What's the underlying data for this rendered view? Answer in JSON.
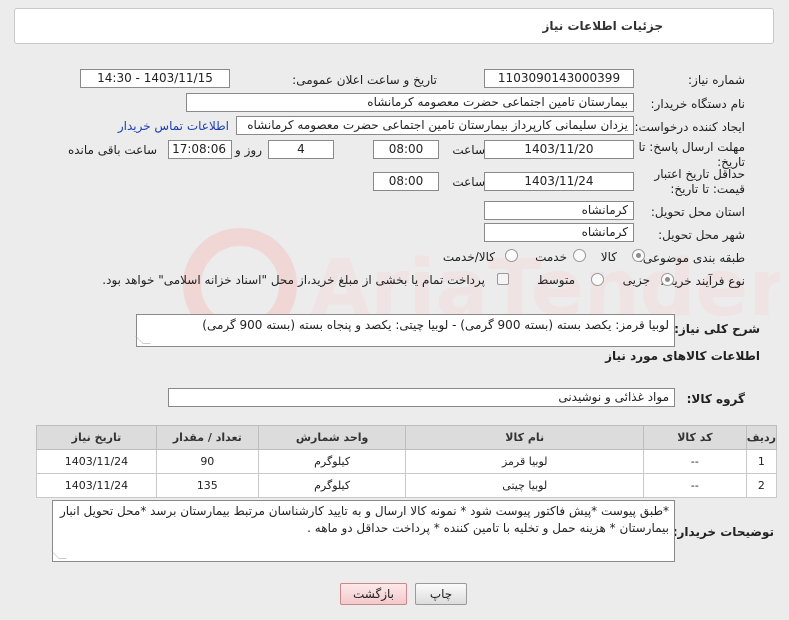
{
  "panel": {
    "title": "جزئیات اطلاعات نیاز"
  },
  "form": {
    "need_number_label": "شماره نیاز:",
    "need_number": "1103090143000399",
    "announce_datetime_label": "تاریخ و ساعت اعلان عمومی:",
    "announce_datetime": "1403/11/15 - 14:30",
    "buyer_org_label": "نام دستگاه خریدار:",
    "buyer_org": "بیمارستان تامین اجتماعی حضرت معصومه کرمانشاه",
    "requester_label": "ایجاد کننده درخواست:",
    "requester": "یزدان  سلیمانی کارپرداز بیمارستان تامین اجتماعی حضرت معصومه کرمانشاه",
    "contact_link": "اطلاعات تماس خریدار",
    "deadline_label": "مهلت ارسال پاسخ: تا تاریخ:",
    "deadline_date": "1403/11/20",
    "time_label": "ساعت",
    "deadline_time": "08:00",
    "days": "4",
    "days_label": "روز و",
    "remaining_time": "17:08:06",
    "remaining_label": "ساعت باقی مانده",
    "min_validity_label": "حداقل تاریخ اعتبار قیمت: تا تاریخ:",
    "validity_date": "1403/11/24",
    "validity_time": "08:00",
    "province_label": "استان محل تحویل:",
    "province": "کرمانشاه",
    "city_label": "شهر محل تحویل:",
    "city": "کرمانشاه",
    "category_label": "طبقه بندی موضوعی:",
    "category_options": [
      "کالا",
      "خدمت",
      "کالا/خدمت"
    ],
    "purchase_type_label": "نوع فرآیند خرید :",
    "purchase_options": [
      "جزیی",
      "متوسط"
    ],
    "treasury_note": "پرداخت تمام یا بخشی از مبلغ خرید،از محل \"اسناد خزانه اسلامی\" خواهد بود.",
    "description_label": "شرح کلی نیاز:",
    "description": "لوبیا قرمز: یکصد بسته (بسته 900 گرمی) - لوبیا چیتی: یکصد و پنجاه بسته (بسته 900 گرمی)",
    "goods_info_title": "اطلاعات کالاهای مورد نیاز",
    "goods_group_label": "گروه کالا:",
    "goods_group": "مواد غذائی و نوشیدنی",
    "buyer_notes_label": "توضیحات خریدار:",
    "buyer_notes": "*طبق پیوست *پیش فاکتور پیوست شود * نمونه کالا ارسال و به تایید کارشناسان مرتبط بیمارستان برسد *محل تحویل انبار بیمارستان * هزینه حمل و تخلیه با تامین کننده * پرداخت حداقل دو ماهه ."
  },
  "table": {
    "headers": [
      "ردیف",
      "کد کالا",
      "نام کالا",
      "واحد شمارش",
      "تعداد / مقدار",
      "تاریخ نیاز"
    ],
    "rows": [
      [
        "1",
        "--",
        "لوبیا قرمز",
        "کیلوگرم",
        "90",
        "1403/11/24"
      ],
      [
        "2",
        "--",
        "لوبیا چیتی",
        "کیلوگرم",
        "135",
        "1403/11/24"
      ]
    ]
  },
  "buttons": {
    "print": "چاپ",
    "back": "بازگشت"
  },
  "colors": {
    "link": "#1a3fb0",
    "header_bg": "#dcdcdc",
    "back_button": "#f3c9cc"
  }
}
